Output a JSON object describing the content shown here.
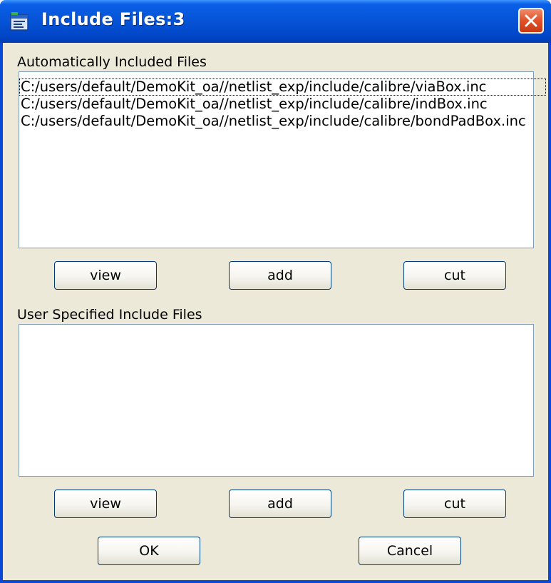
{
  "window": {
    "title": "Include Files:3",
    "icon": "app-window-icon",
    "close_icon": "close-icon"
  },
  "auto_section": {
    "label": "Automatically Included Files",
    "files": [
      "C:/users/default/DemoKit_oa//netlist_exp/include/calibre/viaBox.inc",
      "C:/users/default/DemoKit_oa//netlist_exp/include/calibre/indBox.inc",
      "C:/users/default/DemoKit_oa//netlist_exp/include/calibre/bondPadBox.inc"
    ],
    "buttons": {
      "view": "view",
      "add": "add",
      "cut": "cut"
    }
  },
  "user_section": {
    "label": "User Specified Include Files",
    "files": [],
    "buttons": {
      "view": "view",
      "add": "add",
      "cut": "cut"
    }
  },
  "dialog_buttons": {
    "ok": "OK",
    "cancel": "Cancel"
  },
  "colors": {
    "titlebar": "#0653d6",
    "dialog_bg": "#ece9d8",
    "close_button": "#e2552d",
    "list_border": "#7f9db9"
  }
}
